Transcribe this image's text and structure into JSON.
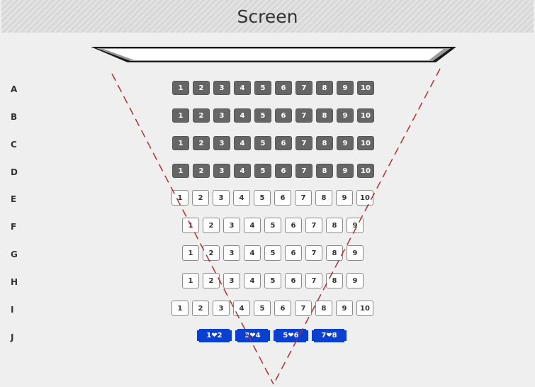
{
  "header": {
    "title": "Screen"
  },
  "colors": {
    "occupied": "#666666",
    "available": "#ffffff",
    "couple": "#0a3fd0",
    "sightline": "#b03030"
  },
  "rows": [
    {
      "label": "A",
      "type": "occupied",
      "seats": [
        "1",
        "2",
        "3",
        "4",
        "5",
        "6",
        "7",
        "8",
        "9",
        "10"
      ]
    },
    {
      "label": "B",
      "type": "occupied",
      "seats": [
        "1",
        "2",
        "3",
        "4",
        "5",
        "6",
        "7",
        "8",
        "9",
        "10"
      ]
    },
    {
      "label": "C",
      "type": "occupied",
      "seats": [
        "1",
        "2",
        "3",
        "4",
        "5",
        "6",
        "7",
        "8",
        "9",
        "10"
      ]
    },
    {
      "label": "D",
      "type": "occupied",
      "seats": [
        "1",
        "2",
        "3",
        "4",
        "5",
        "6",
        "7",
        "8",
        "9",
        "10"
      ]
    },
    {
      "label": "E",
      "type": "available",
      "seats": [
        "1",
        "2",
        "3",
        "4",
        "5",
        "6",
        "7",
        "8",
        "9",
        "10"
      ]
    },
    {
      "label": "F",
      "type": "available",
      "seats": [
        "1",
        "2",
        "3",
        "4",
        "5",
        "6",
        "7",
        "8",
        "9"
      ]
    },
    {
      "label": "G",
      "type": "available",
      "seats": [
        "1",
        "2",
        "3",
        "4",
        "5",
        "6",
        "7",
        "8",
        "9"
      ]
    },
    {
      "label": "H",
      "type": "available",
      "seats": [
        "1",
        "2",
        "3",
        "4",
        "5",
        "6",
        "7",
        "8",
        "9"
      ]
    },
    {
      "label": "I",
      "type": "available",
      "seats": [
        "1",
        "2",
        "3",
        "4",
        "5",
        "6",
        "7",
        "8",
        "9",
        "10"
      ]
    },
    {
      "label": "J",
      "type": "couple",
      "seats": [
        "1❤2",
        "3❤4",
        "5❤6",
        "7❤8"
      ]
    }
  ]
}
